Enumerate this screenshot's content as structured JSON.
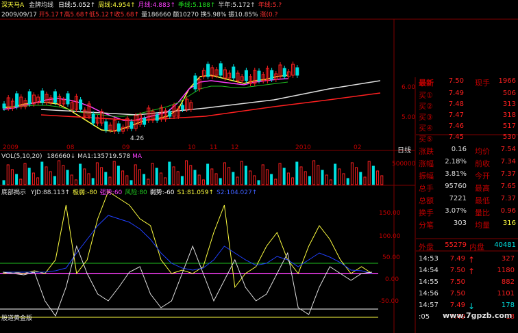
{
  "colors": {
    "up": "#ff2020",
    "down": "#00e0e0",
    "yellow": "#ffff40",
    "white": "#e8e8e8",
    "magenta": "#ff40ff",
    "green": "#20c020",
    "blue": "#2040ff",
    "axis": "#c00000"
  },
  "header": {
    "stock": "深天马A",
    "ma_title": "金牌均线",
    "ma": [
      {
        "label": "日线:",
        "value": "5.052↑",
        "color": "#ffffff"
      },
      {
        "label": "周线:",
        "value": "4.954↑",
        "color": "#ffff40"
      },
      {
        "label": "月线:",
        "value": "4.883↑",
        "color": "#ff40ff"
      },
      {
        "label": "季线:",
        "value": "5.188↑",
        "color": "#20e020"
      },
      {
        "label": "半年:",
        "value": "5.172↑",
        "color": "#e0e0e0"
      },
      {
        "label": "年线:",
        "value": "5.?",
        "color": "#ff3030"
      }
    ],
    "date": "2009/09/17",
    "ohlc": [
      {
        "label": "开",
        "value": "5.17"
      },
      {
        "label": "高",
        "value": "5.68"
      },
      {
        "label": "低",
        "value": "5.12"
      },
      {
        "label": "收",
        "value": "5.68"
      }
    ],
    "vol": "量186660",
    "amt": "额10270",
    "turnover": "换5.98%",
    "amp": "振10.85%",
    "chg": "涨(0.?"
  },
  "price_axis": [
    "6.00",
    "5.00"
  ],
  "min_label": "4.26",
  "date_axis": [
    "2009",
    "08",
    "09",
    "10",
    "11",
    "12",
    "2010",
    "02"
  ],
  "period": "日线",
  "vol_panel": {
    "title": "VOL(5,10,20)",
    "value": "186660",
    "ma_label": "MA1:135719.578",
    "ma2": "MA",
    "axis": "500000"
  },
  "ind_panel": {
    "title": "底部揭示",
    "items": [
      {
        "text": "YJD:88.113↑",
        "color": "#e0e0e0"
      },
      {
        "text": "极弱:-80",
        "color": "#ffff40"
      },
      {
        "text": "强势:60",
        "color": "#ff40ff"
      },
      {
        "text": "风险:80",
        "color": "#20d020"
      },
      {
        "text": "弱势:-60",
        "color": "#ffffff"
      },
      {
        "text": "S1:81.059↑",
        "color": "#ffff40"
      },
      {
        "text": "S2:104.027↑",
        "color": "#4060ff"
      }
    ],
    "axis": [
      "150.00",
      "100.00",
      "50.00",
      "0.00",
      "-50.00"
    ],
    "footer": "股道黄金版"
  },
  "quote": {
    "latest": {
      "l": "最新",
      "v": "7.50",
      "l2": "现手",
      "v2": "1966"
    },
    "bids": [
      {
        "l": "买①",
        "p": "7.49",
        "q": "506"
      },
      {
        "l": "买②",
        "p": "7.48",
        "q": "313"
      },
      {
        "l": "买③",
        "p": "7.47",
        "q": "318"
      },
      {
        "l": "买④",
        "p": "7.46",
        "q": "517"
      },
      {
        "l": "买⑤",
        "p": "7.45",
        "q": "530"
      }
    ],
    "stats": [
      {
        "l": "涨跌",
        "v": "0.16",
        "l2": "均价",
        "v2": "7.54"
      },
      {
        "l": "涨幅",
        "v": "2.18%",
        "l2": "前收",
        "v2": "7.34"
      },
      {
        "l": "振幅",
        "v": "3.81%",
        "l2": "今开",
        "v2": "7.37"
      },
      {
        "l": "总手",
        "v": "95760",
        "l2": "最高",
        "v2": "7.65"
      },
      {
        "l": "总额",
        "v": "7221",
        "l2": "最低",
        "v2": "7.37"
      },
      {
        "l": "换手",
        "v": "3.07%",
        "l2": "量比",
        "v2": "0.96"
      },
      {
        "l": "分笔",
        "v": "303",
        "l2": "均量",
        "v2": "316"
      }
    ],
    "outer": {
      "l": "外盘",
      "v": "55279",
      "l2": "内盘",
      "v2": "40481"
    },
    "ticks": [
      {
        "t": "14:53",
        "p": "7.49",
        "arrow": "↑",
        "v": "327"
      },
      {
        "t": "14:54",
        "p": "7.50",
        "arrow": "↑",
        "v": "1180"
      },
      {
        "t": "14:55",
        "p": "7.50",
        "arrow": "",
        "v": "882"
      },
      {
        "t": "14:56",
        "p": "7.50",
        "arrow": "",
        "v": "1101"
      },
      {
        "t": "14:57",
        "p": "7.49",
        "arrow": "↓",
        "v": "178"
      },
      {
        "t": ":05",
        "p": "7.49",
        "arrow": "",
        "v": "18"
      }
    ]
  },
  "watermark": "www.7gpzb.com"
}
